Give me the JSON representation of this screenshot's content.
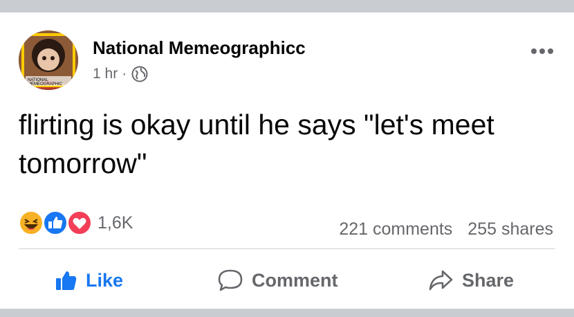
{
  "post": {
    "author": "National Memeographicc",
    "time": "1 hr",
    "separator": "·",
    "privacy_icon": "globe-icon",
    "avatar_caption_line1": "NATIONAL",
    "avatar_caption_line2": "MEMEOGRAPHIC",
    "text": "flirting is okay until he says \"let's meet tomorrow\""
  },
  "reactions": {
    "icons": [
      "haha-icon",
      "like-icon",
      "love-icon"
    ],
    "count": "1,6K"
  },
  "stats": {
    "comments": "221 comments",
    "shares": "255 shares"
  },
  "actions": {
    "like": "Like",
    "comment": "Comment",
    "share": "Share"
  },
  "colors": {
    "like_blue": "#1877f2",
    "love_red": "#f33e58",
    "haha_yellow": "#f7b125",
    "secondary_text": "#65676b",
    "frame_gray": "#c9ccd1"
  }
}
